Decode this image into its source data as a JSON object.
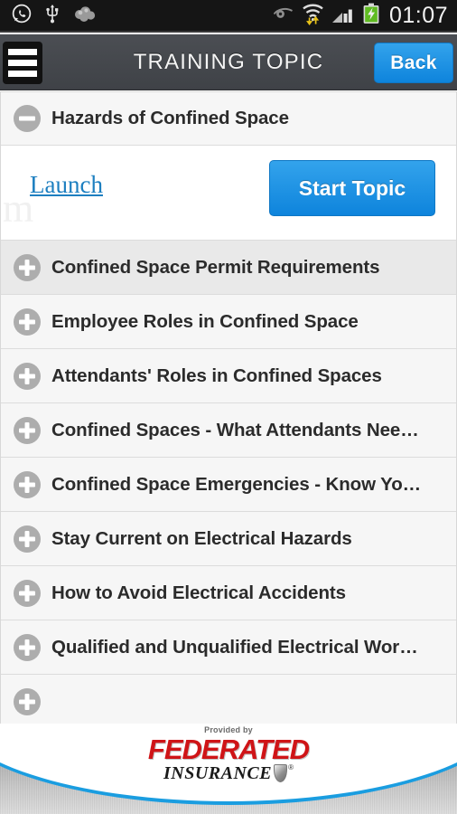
{
  "statusbar": {
    "left_icons": [
      "whatsapp-icon",
      "usb-icon",
      "cloud-icon"
    ],
    "right_icons": [
      "eye-icon",
      "wifi-icon",
      "signal-icon",
      "battery-charging-icon"
    ],
    "time": "01:07"
  },
  "header": {
    "menu_icon": "hamburger-menu-icon",
    "title": "TRAINING TOPIC",
    "back_label": "Back"
  },
  "list": {
    "expanded_item": {
      "label": "Hazards of Confined Space",
      "icon": "minus-circle-icon",
      "launch_label": "Launch",
      "start_label": "Start Topic",
      "ghost_text": "m"
    },
    "items": [
      {
        "label": "Confined Space Permit Requirements",
        "icon": "plus-circle-icon"
      },
      {
        "label": "Employee Roles in Confined Space",
        "icon": "plus-circle-icon"
      },
      {
        "label": "Attendants' Roles in Confined Spaces",
        "icon": "plus-circle-icon"
      },
      {
        "label": "Confined Spaces - What Attendants Nee…",
        "icon": "plus-circle-icon"
      },
      {
        "label": "Confined Space Emergencies - Know Yo…",
        "icon": "plus-circle-icon"
      },
      {
        "label": "Stay Current on Electrical Hazards",
        "icon": "plus-circle-icon"
      },
      {
        "label": "How to Avoid Electrical Accidents",
        "icon": "plus-circle-icon"
      },
      {
        "label": "Qualified and Unqualified Electrical Wor…",
        "icon": "plus-circle-icon"
      }
    ]
  },
  "footer": {
    "provided_by": "Provided by",
    "brand": "FEDERATED",
    "brand_sub": "INSURANCE",
    "registered_mark": "®"
  },
  "colors": {
    "accent_blue": "#1a9de0",
    "button_blue": "#0e84dc",
    "link_blue": "#1d7fc0",
    "brand_red": "#cf1417",
    "header_gray": "#45484d",
    "row_gray": "#f6f6f6"
  }
}
